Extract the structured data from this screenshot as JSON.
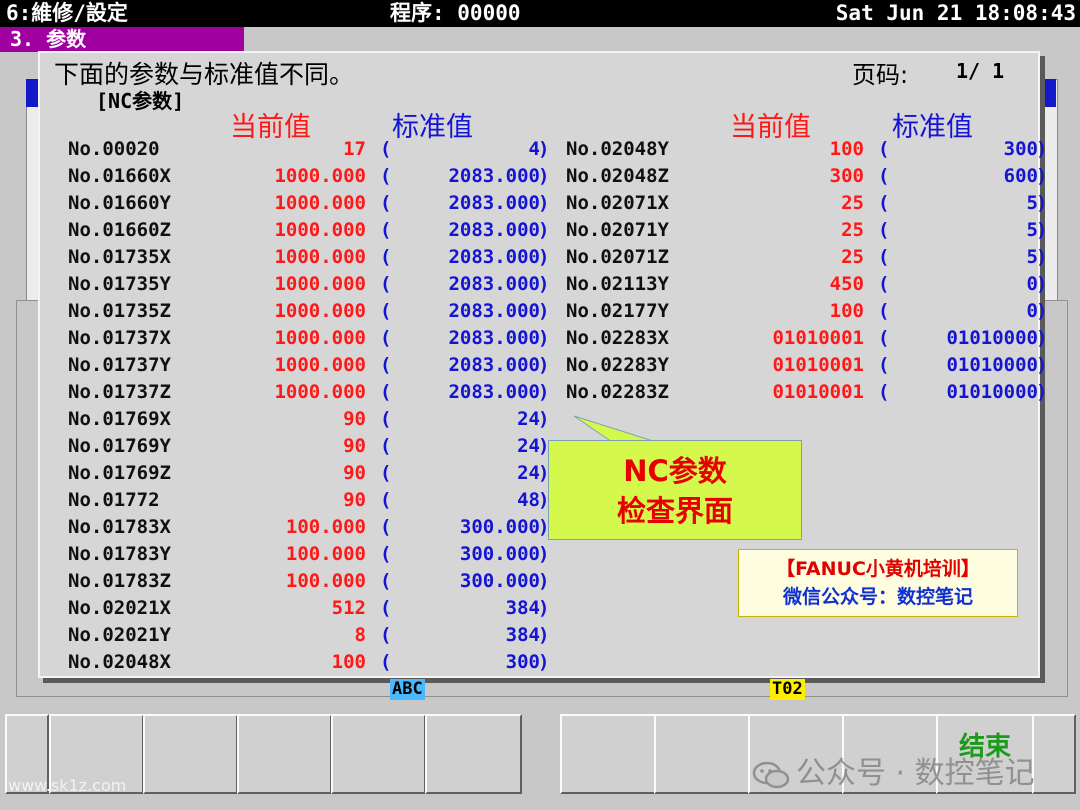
{
  "header": {
    "screen_title": "6:維修/設定",
    "program": "程序: 00000",
    "datetime": "Sat Jun 21 18:08:43"
  },
  "menu_tab": "3. 参数",
  "dialog": {
    "message": "下面的参数与标准值不同。",
    "page_label": "页码:",
    "page_value": "1/  1",
    "section": "[NC参数]",
    "col_current": "当前值",
    "col_standard": "标准值",
    "left_rows": [
      {
        "no": "No.00020",
        "cur": "17",
        "std": "4"
      },
      {
        "no": "No.01660X",
        "cur": "1000.000",
        "std": "2083.000"
      },
      {
        "no": "No.01660Y",
        "cur": "1000.000",
        "std": "2083.000"
      },
      {
        "no": "No.01660Z",
        "cur": "1000.000",
        "std": "2083.000"
      },
      {
        "no": "No.01735X",
        "cur": "1000.000",
        "std": "2083.000"
      },
      {
        "no": "No.01735Y",
        "cur": "1000.000",
        "std": "2083.000"
      },
      {
        "no": "No.01735Z",
        "cur": "1000.000",
        "std": "2083.000"
      },
      {
        "no": "No.01737X",
        "cur": "1000.000",
        "std": "2083.000"
      },
      {
        "no": "No.01737Y",
        "cur": "1000.000",
        "std": "2083.000"
      },
      {
        "no": "No.01737Z",
        "cur": "1000.000",
        "std": "2083.000"
      },
      {
        "no": "No.01769X",
        "cur": "90",
        "std": "24"
      },
      {
        "no": "No.01769Y",
        "cur": "90",
        "std": "24"
      },
      {
        "no": "No.01769Z",
        "cur": "90",
        "std": "24"
      },
      {
        "no": "No.01772",
        "cur": "90",
        "std": "48"
      },
      {
        "no": "No.01783X",
        "cur": "100.000",
        "std": "300.000"
      },
      {
        "no": "No.01783Y",
        "cur": "100.000",
        "std": "300.000"
      },
      {
        "no": "No.01783Z",
        "cur": "100.000",
        "std": "300.000"
      },
      {
        "no": "No.02021X",
        "cur": "512",
        "std": "384"
      },
      {
        "no": "No.02021Y",
        "cur": "8",
        "std": "384"
      },
      {
        "no": "No.02048X",
        "cur": "100",
        "std": "300"
      }
    ],
    "right_rows": [
      {
        "no": "No.02048Y",
        "cur": "100",
        "std": "300"
      },
      {
        "no": "No.02048Z",
        "cur": "300",
        "std": "600"
      },
      {
        "no": "No.02071X",
        "cur": "25",
        "std": "5"
      },
      {
        "no": "No.02071Y",
        "cur": "25",
        "std": "5"
      },
      {
        "no": "No.02071Z",
        "cur": "25",
        "std": "5"
      },
      {
        "no": "No.02113Y",
        "cur": "450",
        "std": "0"
      },
      {
        "no": "No.02177Y",
        "cur": "100",
        "std": "0"
      },
      {
        "no": "No.02283X",
        "cur": "01010001",
        "std": "01010000"
      },
      {
        "no": "No.02283Y",
        "cur": "01010001",
        "std": "01010000"
      },
      {
        "no": "No.02283Z",
        "cur": "01010001",
        "std": "01010000"
      }
    ],
    "open_paren": "(",
    "close_paren": ")"
  },
  "callout": {
    "line1": "NC参数",
    "line2": "检查界面"
  },
  "watermark_box": {
    "line1": "【FANUC小黄机培训】",
    "line2": "微信公众号：数控笔记"
  },
  "indicators": {
    "input_mode": "ABC",
    "tool": "T02"
  },
  "softkeys": [
    "",
    "",
    "",
    "",
    "",
    "",
    "",
    "",
    "",
    "",
    "结束",
    ""
  ],
  "watermark": {
    "text": "公众号 · 数控笔记",
    "site": "www.sk1z.com"
  },
  "colors": {
    "current": "#ff1818",
    "standard": "#1414d2",
    "callout_bg": "#d4f84c",
    "menu_tab": "#a000a0"
  }
}
